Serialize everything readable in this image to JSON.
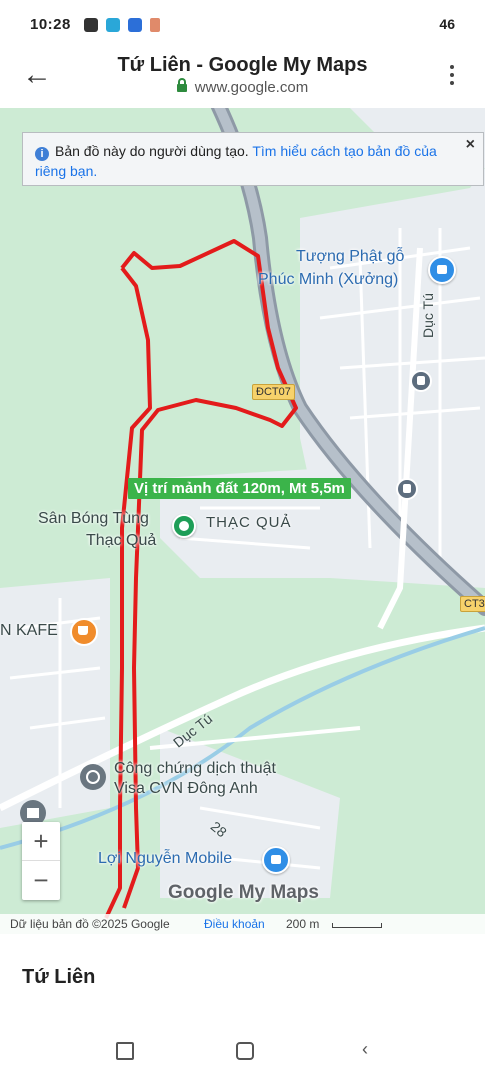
{
  "status_bar": {
    "time": "10:28",
    "right_text": "46"
  },
  "header": {
    "back_icon": "arrow-left-icon",
    "title": "Tứ Liên - Google My Maps",
    "url": "www.google.com",
    "menu_icon": "more-vert-icon"
  },
  "banner": {
    "text": "Bản đồ này do người dùng tạo.",
    "link": "Tìm hiểu cách tạo bản đồ của riêng bạn.",
    "close": "×"
  },
  "map": {
    "parcel_label": "Vị trí mảnh đất 120m, Mt 5,5m",
    "parcel_color": "#e31b1b",
    "labels": {
      "statue_line1": "Tượng Phật gỗ",
      "statue_line2": "Phúc Minh (Xưởng)",
      "road_duc_tu_right": "Dục Tú",
      "road_badge_dct": "ĐCT07",
      "field_line1": "Sân Bóng Tùng",
      "field_line2": "Thạc Quả",
      "village": "THẠC QUẢ",
      "road_badge_ct": "CT3",
      "cafe": "N KAFE",
      "road_duc_tu_left": "Dục Tú",
      "notary_line1": "Công chứng dịch thuật",
      "notary_line2": "Visa CVN Đông Anh",
      "road_number": "28",
      "mobile_shop": "Lợi Nguyễn Mobile",
      "logo": "Google My Maps"
    },
    "zoom_in": "+",
    "zoom_out": "−",
    "attribution": "Dữ liệu bản đồ ©2025 Google",
    "terms": "Điều khoản",
    "scale": "200 m"
  },
  "sheet": {
    "title": "Tứ Liên"
  },
  "nav": {
    "recent_icon": "recent-apps-icon",
    "home_icon": "home-icon",
    "back_icon": "back-icon"
  }
}
